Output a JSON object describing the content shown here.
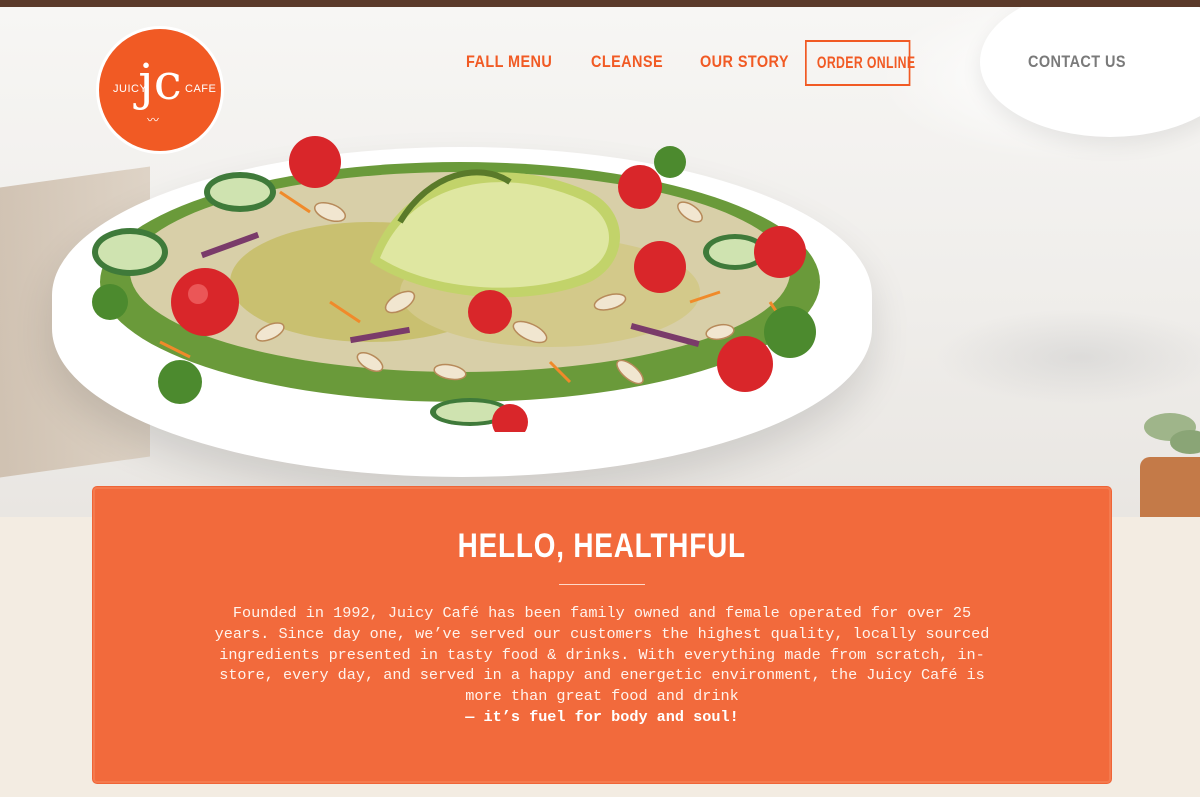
{
  "logo": {
    "left": "JUICY",
    "monogram": "jc",
    "right": "CAFE"
  },
  "nav": {
    "fall_menu": "FALL MENU",
    "cleanse": "CLEANSE",
    "our_story": "OUR STORY",
    "order_online": "ORDER ONLINE",
    "contact_us": "CONTACT US"
  },
  "intro": {
    "title": "HELLO, HEALTHFUL",
    "body": "Founded in 1992, Juicy Café has been family owned and female operated for over 25 years. Since day one, we’ve served our customers the highest quality, locally sourced ingredients presented in tasty food & drinks. With everything made from scratch, in-store, every day, and served in a happy and energetic environment, the Juicy Café is more than great food and drink",
    "tagline": "— it’s fuel for body and soul!"
  },
  "colors": {
    "brand_orange": "#f15a24",
    "card_orange": "#f26a3c",
    "contact_gray": "#7a7a7a"
  }
}
